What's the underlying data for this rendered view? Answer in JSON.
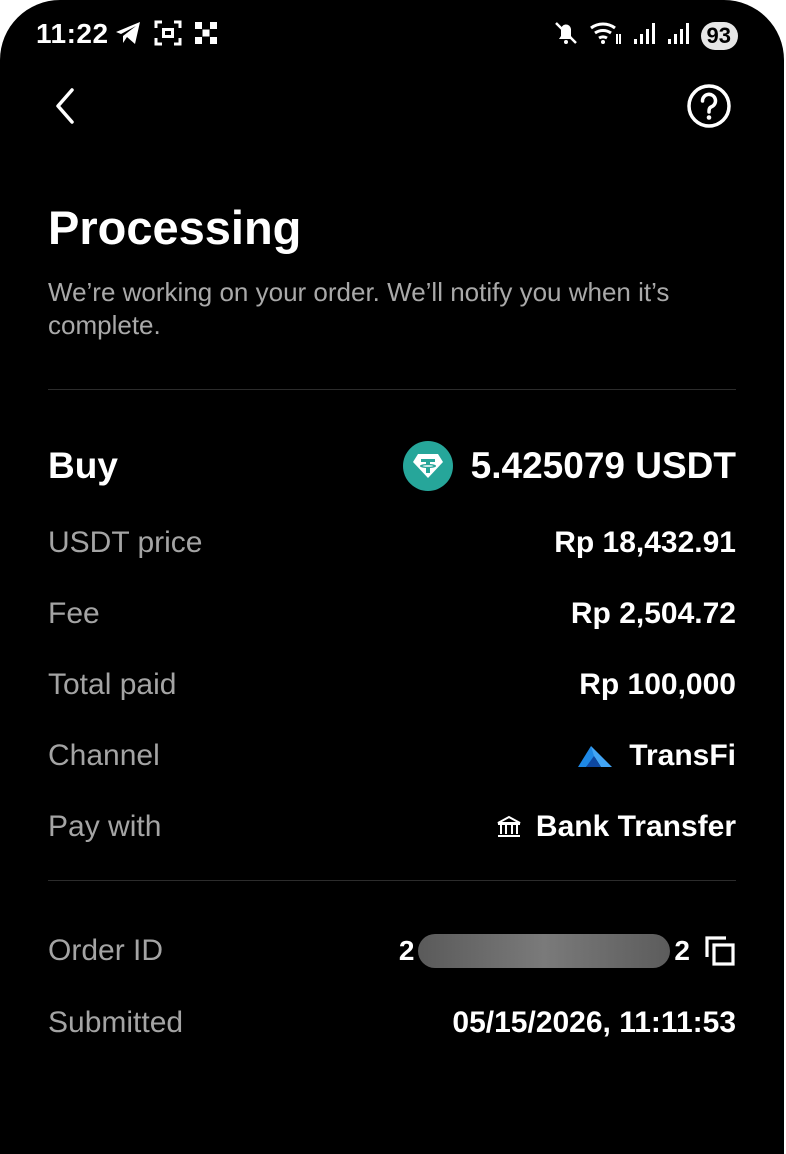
{
  "status_bar": {
    "time": "11:22",
    "battery": "93",
    "left_icons": [
      "telegram-icon",
      "screen-capture-icon",
      "app-grid-icon"
    ],
    "right_icons": [
      "mute-icon",
      "wifi-icon",
      "signal-icon",
      "signal-icon"
    ]
  },
  "nav": {
    "back_icon": "chevron-left-icon",
    "help_icon": "help-circle-icon"
  },
  "header": {
    "title": "Processing",
    "subtitle": "We’re working on your order. We’ll notify you when it’s complete."
  },
  "order": {
    "buy_label": "Buy",
    "buy_amount": "5.425079 USDT",
    "rows": [
      {
        "label": "USDT price",
        "value": "Rp 18,432.91"
      },
      {
        "label": "Fee",
        "value": "Rp 2,504.72"
      },
      {
        "label": "Total paid",
        "value": "Rp 100,000"
      },
      {
        "label": "Channel",
        "value": "TransFi"
      },
      {
        "label": "Pay with",
        "value": "Bank Transfer"
      }
    ]
  },
  "meta": {
    "order_id_label": "Order ID",
    "order_id_start": "2",
    "order_id_end": "2",
    "submitted_label": "Submitted",
    "submitted_value": "05/15/2026, 11:11:53"
  },
  "colors": {
    "tether_green": "#26a69a",
    "background": "#000000",
    "muted_text": "#a4a4a4"
  }
}
